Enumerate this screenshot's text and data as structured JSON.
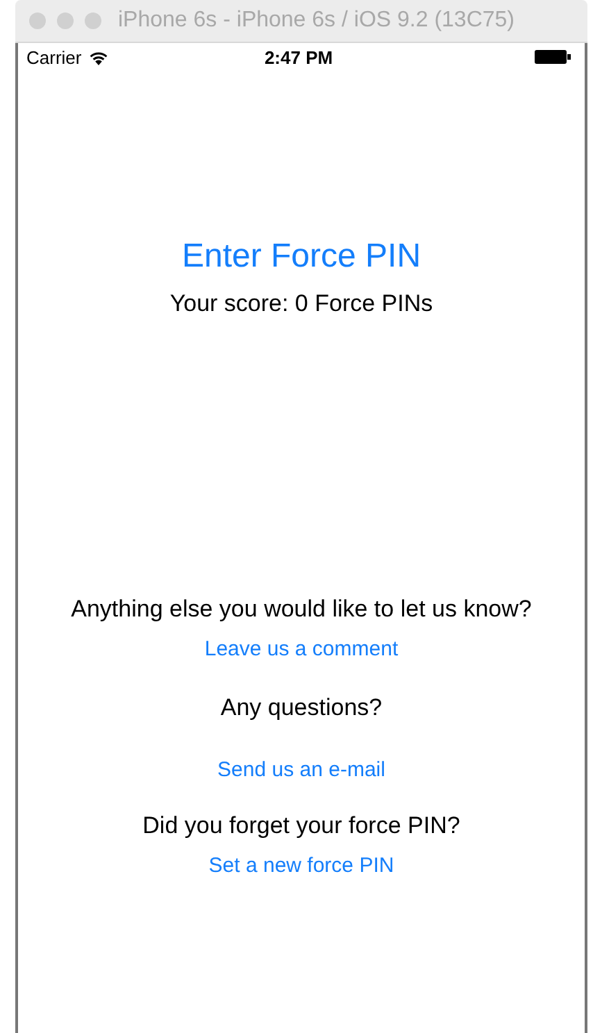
{
  "window": {
    "title": "iPhone 6s - iPhone 6s / iOS 9.2 (13C75)"
  },
  "status_bar": {
    "carrier": "Carrier",
    "time": "2:47 PM"
  },
  "heading": "Enter Force PIN",
  "score": "Your score: 0 Force PINs",
  "sections": [
    {
      "prompt": "Anything else you would like to let us know?",
      "link": "Leave us a comment"
    },
    {
      "prompt": "Any questions?",
      "link": "Send us an e-mail"
    },
    {
      "prompt": "Did you forget your force PIN?",
      "link": "Set a new force PIN"
    }
  ]
}
